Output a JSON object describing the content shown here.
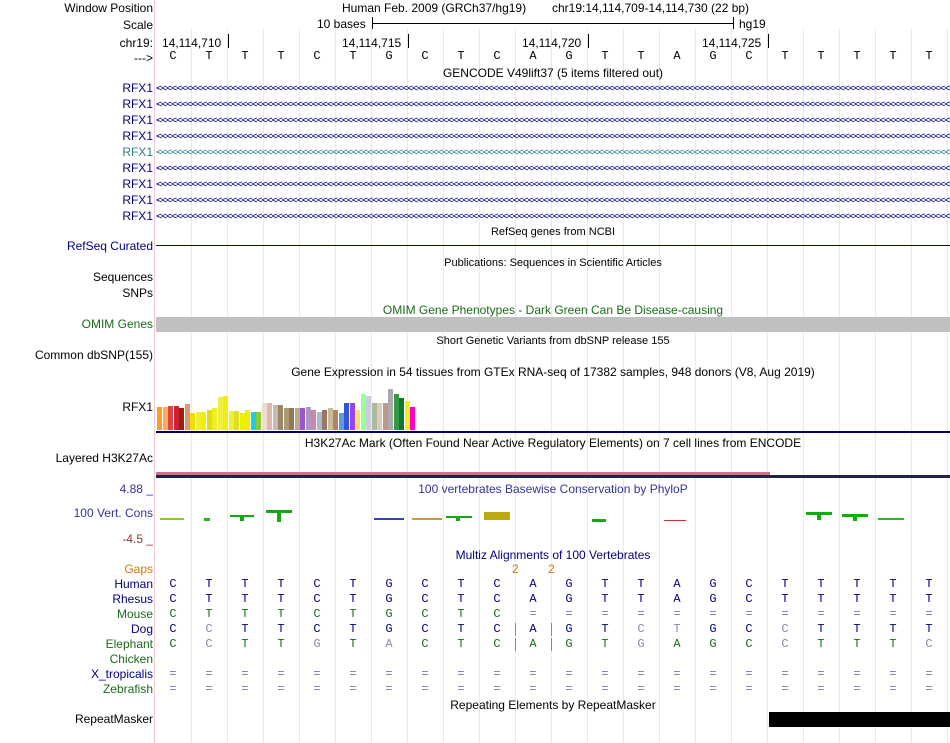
{
  "header": {
    "window_position_label": "Window Position",
    "scale_label": "Scale",
    "chrom_label": "chr19:",
    "strand_label": "--->",
    "assembly": "Human Feb. 2009 (GRCh37/hg19)",
    "position": "chr19:14,114,709-14,114,730 (22 bp)",
    "scale_text": "10 bases",
    "db": "hg19",
    "ticks": [
      "14,114,710",
      "14,114,715",
      "14,114,720",
      "14,114,725"
    ]
  },
  "sequence": [
    "C",
    "T",
    "T",
    "T",
    "C",
    "T",
    "G",
    "C",
    "T",
    "C",
    "A",
    "G",
    "T",
    "T",
    "A",
    "G",
    "C",
    "T",
    "T",
    "T",
    "T",
    "T"
  ],
  "gencode": {
    "title": "GENCODE V49lift37 (5 items filtered out)",
    "items": [
      "RFX1",
      "RFX1",
      "RFX1",
      "RFX1",
      "RFX1",
      "RFX1",
      "RFX1",
      "RFX1",
      "RFX1"
    ]
  },
  "refseq": {
    "title": "RefSeq genes from NCBI",
    "label": "RefSeq Curated"
  },
  "publications": {
    "title": "Publications: Sequences in Scientific Articles",
    "label1": "Sequences",
    "label2": "SNPs"
  },
  "omim": {
    "title": "OMIM Gene Phenotypes - Dark Green Can Be Disease-causing",
    "label": "OMIM Genes"
  },
  "dbsnp": {
    "title": "Short Genetic Variants from dbSNP release 155",
    "label": "Common dbSNP(155)"
  },
  "gtex": {
    "title": "Gene Expression in 54 tissues from GTEx RNA-seq of 17382 samples, 948 donors (V8, Aug 2019)",
    "label": "RFX1",
    "colors": [
      "#ff9933",
      "#ffaa55",
      "#dd4444",
      "#cc2233",
      "#992200",
      "#dd9977",
      "#eedd00",
      "#eeee33",
      "#eeee00",
      "#dddd11",
      "#eeee22",
      "#eeee44",
      "#eeee11",
      "#eeee33",
      "#dddd22",
      "#eeee00",
      "#eeee00",
      "#22ccdd",
      "#88cc33",
      "#eeddcc",
      "#ddbbaa",
      "#ccbbaa",
      "#998866",
      "#aa9977",
      "#997755",
      "#bbaa88",
      "#9955cc",
      "#aa99bb",
      "#cc88aa",
      "#aabbcc",
      "#997766",
      "#ccbb99",
      "#aa8866",
      "#6699cc",
      "#3355dd",
      "#9944ee",
      "#ffdd66",
      "#99ff99",
      "#ccccdd",
      "#aabb99",
      "#ddccbb",
      "#bb9988",
      "#aaaaaa",
      "#339944",
      "#117733",
      "#eeee22",
      "#ff00cc"
    ],
    "values": [
      0.65,
      0.65,
      0.68,
      0.68,
      0.62,
      0.72,
      0.47,
      0.5,
      0.5,
      0.55,
      0.62,
      0.93,
      0.95,
      0.52,
      0.53,
      0.47,
      0.55,
      0.5,
      0.5,
      0.75,
      0.74,
      0.7,
      0.7,
      0.6,
      0.6,
      0.62,
      0.62,
      0.65,
      0.55,
      0.5,
      0.55,
      0.6,
      0.55,
      0.47,
      0.75,
      0.75,
      0.55,
      1.0,
      0.95,
      0.75,
      0.75,
      0.75,
      1.15,
      1.0,
      0.9,
      0.8,
      0.65
    ]
  },
  "h3k27ac": {
    "title": "H3K27Ac Mark (Often Found Near Active Regulatory Elements) on 7 cell lines from ENCODE",
    "label": "Layered H3K27Ac"
  },
  "phylop": {
    "title": "100 vertebrates Basewise Conservation by PhyloP",
    "label": "100 Vert. Cons",
    "max": "4.88 _",
    "min": "-4.5 _"
  },
  "multiz": {
    "title": "Multiz Alignments of 100 Vertebrates",
    "gaps_label": "Gaps",
    "gap_marks": [
      "2",
      "2"
    ],
    "species": [
      {
        "name": "Human",
        "color": "#000080",
        "seq": [
          "C",
          "T",
          "T",
          "T",
          "C",
          "T",
          "G",
          "C",
          "T",
          "C",
          "A",
          "G",
          "T",
          "T",
          "A",
          "G",
          "C",
          "T",
          "T",
          "T",
          "T",
          "T"
        ]
      },
      {
        "name": "Rhesus",
        "color": "#000080",
        "seq": [
          "C",
          "T",
          "T",
          "T",
          "C",
          "T",
          "G",
          "C",
          "T",
          "C",
          "A",
          "G",
          "T",
          "T",
          "A",
          "G",
          "C",
          "T",
          "T",
          "T",
          "T",
          "T"
        ]
      },
      {
        "name": "Mouse",
        "color": "#1a6b1a",
        "seq": [
          "C",
          "T",
          "T",
          "T",
          "C",
          "T",
          "G",
          "C",
          "T",
          "C",
          "=",
          "=",
          "=",
          "=",
          "=",
          "=",
          "=",
          "=",
          "=",
          "=",
          "=",
          "="
        ]
      },
      {
        "name": "Dog",
        "color": "#000080",
        "seq": [
          "C",
          "C",
          "T",
          "T",
          "C",
          "T",
          "G",
          "C",
          "T",
          "C",
          "A",
          "G",
          "T",
          "C",
          "T",
          "G",
          "C",
          "C",
          "T",
          "T",
          "T",
          "T"
        ]
      },
      {
        "name": "Elephant",
        "color": "#1a6b1a",
        "seq": [
          "C",
          "C",
          "T",
          "T",
          "G",
          "T",
          "A",
          "C",
          "T",
          "C",
          "A",
          "G",
          "T",
          "G",
          "A",
          "G",
          "C",
          "C",
          "T",
          "T",
          "T",
          "C"
        ]
      },
      {
        "name": "Chicken",
        "color": "#1a6b1a",
        "seq": []
      },
      {
        "name": "X_tropicalis",
        "color": "#000080",
        "seq": [
          "=",
          "=",
          "=",
          "=",
          "=",
          "=",
          "=",
          "=",
          "=",
          "=",
          "=",
          "=",
          "=",
          "=",
          "=",
          "=",
          "=",
          "=",
          "=",
          "=",
          "=",
          "="
        ]
      },
      {
        "name": "Zebrafish",
        "color": "#1a6b1a",
        "seq": [
          "=",
          "=",
          "=",
          "=",
          "=",
          "=",
          "=",
          "=",
          "=",
          "=",
          "=",
          "=",
          "=",
          "=",
          "=",
          "=",
          "=",
          "=",
          "=",
          "=",
          "=",
          "="
        ]
      }
    ]
  },
  "repeatmasker": {
    "title": "Repeating Elements by RepeatMasker",
    "label": "RepeatMasker"
  },
  "colors": {
    "track_label": "#000080",
    "omim": "#1a6b1a",
    "gaps": "#dd7700",
    "selected_gene": "#2a7f8a"
  }
}
